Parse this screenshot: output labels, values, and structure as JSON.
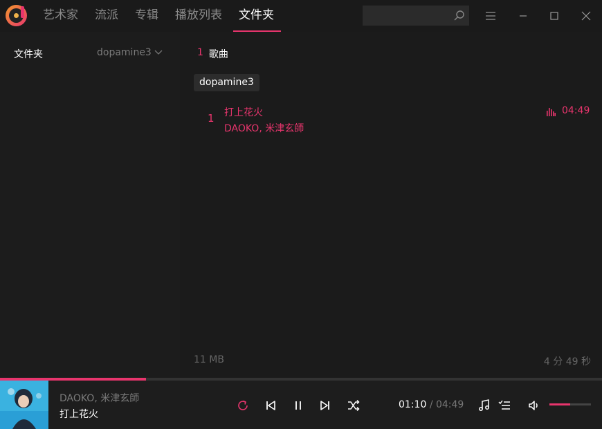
{
  "nav": {
    "items": [
      "艺术家",
      "流派",
      "专辑",
      "播放列表",
      "文件夹"
    ],
    "active_index": 4
  },
  "search": {
    "placeholder": "",
    "value": ""
  },
  "sidebar": {
    "title": "文件夹",
    "folder_selector": "dopamine3"
  },
  "main": {
    "song_count": "1",
    "song_count_label": "歌曲",
    "folder_chip": "dopamine3",
    "songs": [
      {
        "index": "1",
        "title": "打上花火",
        "artist": "DAOKO, 米津玄師",
        "duration": "04:49",
        "playing": true
      }
    ],
    "footer_size": "11 MB",
    "footer_total": "4 分 49 秒"
  },
  "player": {
    "artist": "DAOKO, 米津玄師",
    "title": "打上花火",
    "current_time": "01:10",
    "separator": "/",
    "total_time": "04:49",
    "progress_fraction": 0.242,
    "volume_fraction": 0.5
  },
  "colors": {
    "accent": "#e8356d",
    "background": "#1a1a1a",
    "text_muted": "#7b7b7b"
  },
  "icons": {
    "logo": "dopamine-logo",
    "search": "search-icon",
    "menu": "hamburger-icon",
    "minimize": "minimize-icon",
    "maximize": "maximize-icon",
    "close": "close-icon",
    "chevron": "chevron-down-icon",
    "equalizer": "equalizer-icon",
    "repeat": "repeat-icon",
    "previous": "previous-icon",
    "pause": "pause-icon",
    "next": "next-icon",
    "shuffle": "shuffle-icon",
    "now_playing": "music-note-icon",
    "queue": "queue-icon",
    "volume": "volume-icon"
  }
}
